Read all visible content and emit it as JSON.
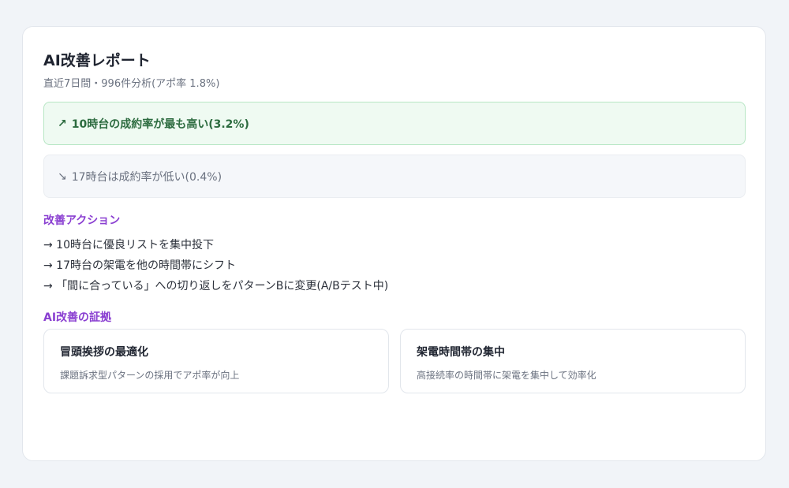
{
  "report": {
    "title": "AI改善レポート",
    "subtitle": "直近7日間・996件分析(アポ率 1.8%)"
  },
  "insights": {
    "good": {
      "arrow": "↗",
      "text": "10時台の成約率が最も高い(3.2%)",
      "color": "#2c6b3f"
    },
    "bad": {
      "arrow": "↘",
      "text": "17時台は成約率が低い(0.4%)",
      "color": "#6b7280"
    }
  },
  "actions": {
    "label": "改善アクション",
    "items": [
      "→ 10時台に優良リストを集中投下",
      "→ 17時台の架電を他の時間帯にシフト",
      "→ 「間に合っている」への切り返しをパターンBに変更(A/Bテスト中)"
    ]
  },
  "evidence": {
    "label": "AI改善の証拠",
    "items": [
      {
        "title": "冒頭挨拶の最適化",
        "desc": "課題訴求型パターンの採用でアポ率が向上"
      },
      {
        "title": "架電時間帯の集中",
        "desc": "高接続率の時間帯に架電を集中して効率化"
      }
    ]
  },
  "colors": {
    "accent": "#8a3fd1",
    "success_bg": "#effaf2"
  }
}
